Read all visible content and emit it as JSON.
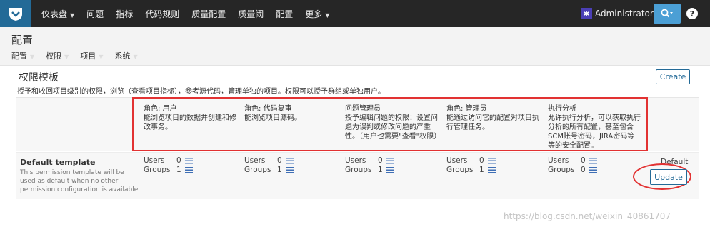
{
  "topbar": {
    "nav": [
      {
        "label": "仪表盘",
        "dropdown": true
      },
      {
        "label": "问题",
        "dropdown": false
      },
      {
        "label": "指标",
        "dropdown": false
      },
      {
        "label": "代码规则",
        "dropdown": false
      },
      {
        "label": "质量配置",
        "dropdown": false
      },
      {
        "label": "质量阈",
        "dropdown": false
      },
      {
        "label": "配置",
        "dropdown": false
      },
      {
        "label": "更多",
        "dropdown": true
      }
    ],
    "user": "Administrator",
    "help": "?"
  },
  "header": {
    "title": "配置",
    "menu": [
      {
        "label": "配置"
      },
      {
        "label": "权限"
      },
      {
        "label": "项目"
      },
      {
        "label": "系统"
      }
    ]
  },
  "section": {
    "title": "权限模板",
    "description": "授予和收回项目级别的权限，浏览（查看项目指标），参考源代码，管理单独的项目。权限可以授予群组或单独用户。",
    "create_label": "Create"
  },
  "permissions": [
    {
      "title": "角色: 用户",
      "desc": "能浏览项目的数据并创建和修改事务。"
    },
    {
      "title": "角色: 代码复审",
      "desc": "能浏览项目源码。"
    },
    {
      "title": "问题管理员",
      "desc": "授予编辑问题的权限：设置问题为误判或修改问题的严重性。（用户也需要\"查看\"权限）"
    },
    {
      "title": "角色: 管理员",
      "desc": "能通过访问它的配置对项目执行管理任务。"
    },
    {
      "title": "执行分析",
      "desc": "允许执行分析，可以获取执行分析的所有配置，甚至包含SCM账号密码，JIRA密码等等的安全配置。"
    }
  ],
  "template": {
    "name": "Default template",
    "description": "This permission template will be used as default when no other permission configuration is available",
    "users_label": "Users",
    "groups_label": "Groups",
    "counts": [
      {
        "users": "0",
        "groups": "1"
      },
      {
        "users": "0",
        "groups": "1"
      },
      {
        "users": "0",
        "groups": "1"
      },
      {
        "users": "0",
        "groups": "1"
      },
      {
        "users": "0",
        "groups": "0"
      }
    ],
    "default_label": "Default",
    "update_label": "Update"
  },
  "watermark": "https://blog.csdn.net/weixin_40861707",
  "colors": {
    "topbar": "#262626",
    "accent": "#236a97",
    "highlight": "#e23232",
    "search": "#4b9fd5"
  }
}
